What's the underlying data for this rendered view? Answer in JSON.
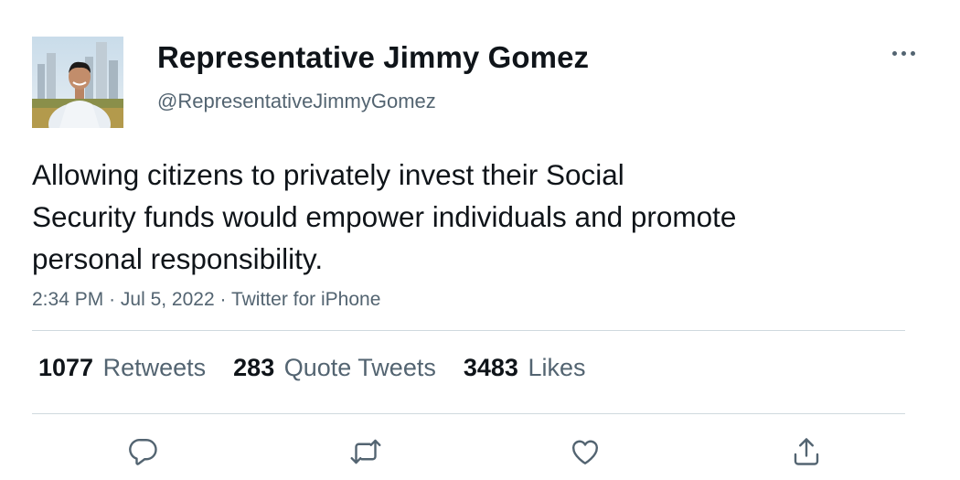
{
  "user": {
    "display_name": "Representative Jimmy Gomez",
    "handle": "@RepresentativeJimmyGomez"
  },
  "tweet": {
    "text_lines": [
      "Allowing citizens to privately invest their Social",
      "Security funds would empower individuals and promote",
      "personal responsibility."
    ],
    "time": "2:34 PM",
    "separator": "·",
    "date": "Jul 5, 2022",
    "source": "Twitter for iPhone"
  },
  "stats": {
    "retweets_count": "1077",
    "retweets_label": "Retweets",
    "quotes_count": "283",
    "quotes_label": "Quote Tweets",
    "likes_count": "3483",
    "likes_label": "Likes"
  },
  "icons": {
    "more": "more-horizontal-icon",
    "reply": "reply-icon",
    "retweet": "retweet-icon",
    "like": "heart-icon",
    "share": "share-icon"
  },
  "colors": {
    "text_primary": "#0f1419",
    "text_secondary": "#536471",
    "divider": "#cfd9de"
  }
}
